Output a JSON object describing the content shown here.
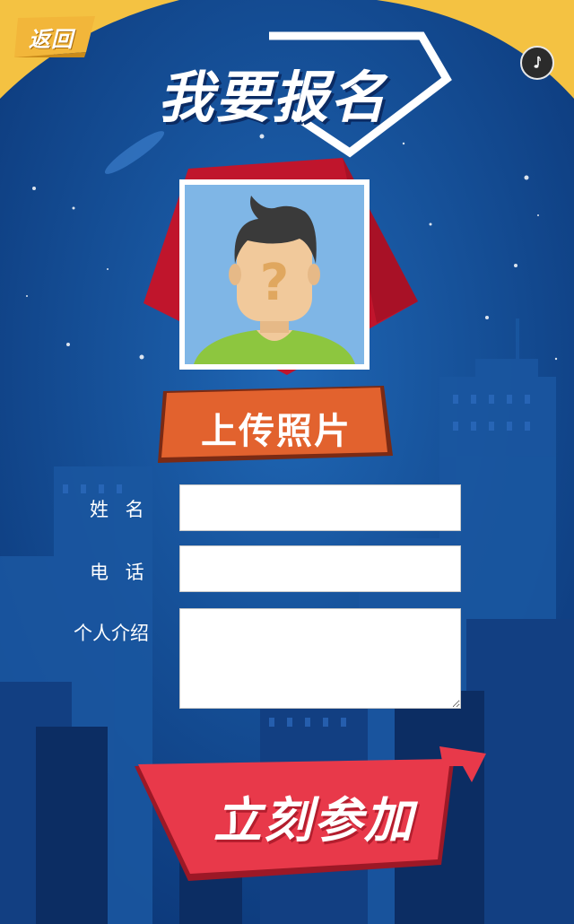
{
  "nav": {
    "back_label": "返回",
    "music_icon": "music-note-icon"
  },
  "title": "我要报名",
  "photo": {
    "placeholder_icon": "avatar-question-icon"
  },
  "upload_label": "上传照片",
  "form": {
    "name_label": "姓  名",
    "name_value": "",
    "phone_label": "电  话",
    "phone_value": "",
    "intro_label": "个人介绍",
    "intro_value": ""
  },
  "join_label": "立刻参加",
  "colors": {
    "bg_blue": "#0f3f86",
    "gold": "#f4c242",
    "red": "#c0152c",
    "orange": "#e2622e",
    "join_red": "#e8394a"
  }
}
